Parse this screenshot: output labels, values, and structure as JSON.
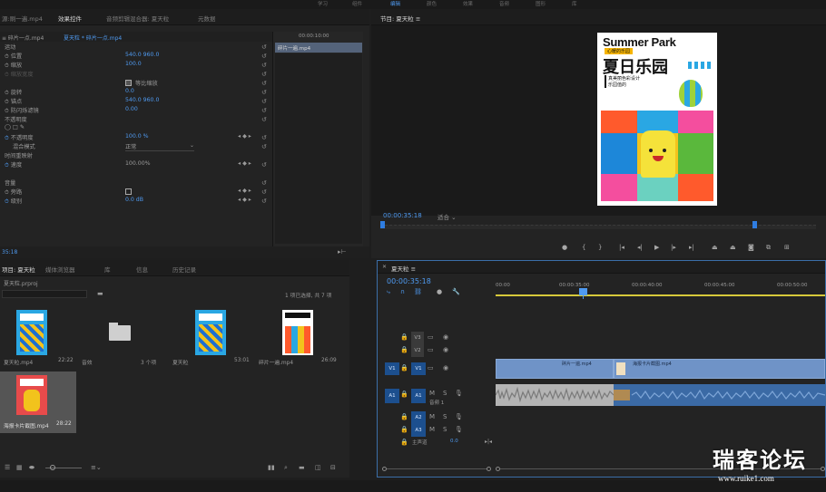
{
  "top_bar": {
    "items": [
      "学习",
      "组件",
      "编辑",
      "颜色",
      "效果",
      "音频",
      "图形",
      "库"
    ]
  },
  "effect_controls": {
    "tabs": [
      "源:刷一遍.mp4",
      "效果控件",
      "音频剪辑混合器: 夏天粒",
      "元数据"
    ],
    "source_path": "≡ 碎片一点.mp4",
    "source_seq": "夏天粒 * 碎片一点.mp4",
    "clip_label": "碎片一遍.mp4",
    "clip_time": "00:00:10:00",
    "sections": [
      "运动",
      "不透明度",
      "时间重映射",
      "音量"
    ],
    "rows": [
      {
        "label": "运动",
        "values": ""
      },
      {
        "label": "位置",
        "values": "540.0   960.0"
      },
      {
        "label": "缩放",
        "values": "100.0"
      },
      {
        "label": "缩放宽度",
        "values": ""
      },
      {
        "label": "",
        "values": "等比缩放"
      },
      {
        "label": "旋转",
        "values": "0.0"
      },
      {
        "label": "锚点",
        "values": "540.0   960.0"
      },
      {
        "label": "防闪烁滤镜",
        "values": "0.00"
      },
      {
        "label": "不透明度",
        "values": ""
      },
      {
        "label": "",
        "values": ""
      },
      {
        "label": "不透明度",
        "values": "100.0 %"
      },
      {
        "label": "混合模式",
        "values": "正常"
      },
      {
        "label": "时间重映射",
        "values": ""
      },
      {
        "label": "速度",
        "values": "100.00%"
      },
      {
        "label": "",
        "values": ""
      },
      {
        "label": "音量",
        "values": ""
      },
      {
        "label": "旁路",
        "values": ""
      },
      {
        "label": "级别",
        "values": "0.0 dB"
      }
    ],
    "time": "35:18"
  },
  "program": {
    "title": "节目: 夏天粒 ≡",
    "timecode": "00:00:35:18",
    "fit": "适合",
    "poster": {
      "title_en": "Summer Park",
      "subtitle_tag": "心暖的乐园",
      "title_cn": "夏日乐园",
      "line1": "真美丽色彩设计",
      "line2": "乐园值的"
    }
  },
  "project": {
    "tabs": [
      "项目: 夏天粒",
      "媒体浏览器",
      "库",
      "信息",
      "历史记录"
    ],
    "file": "夏天粒.prproj",
    "count": "1 项已选择, 共 7 项",
    "items": [
      {
        "name": "夏天粒.mp4",
        "dur": "22:22"
      },
      {
        "name": "音效",
        "dur": "3 个项"
      },
      {
        "name": "夏天粒",
        "dur": "53:01"
      },
      {
        "name": "碎片一遍.mp4",
        "dur": "26:09"
      },
      {
        "name": "海报卡片截图.mp4",
        "dur": "28:22"
      }
    ]
  },
  "timeline": {
    "title": "夏天粒 ≡",
    "timecode": "00:00:35:18",
    "ruler": [
      "00:00",
      "00:00:35:00",
      "00:00:40:00",
      "00:00:45:00",
      "00:00:50:00"
    ],
    "tracks": [
      {
        "id": "V3"
      },
      {
        "id": "V2"
      },
      {
        "id": "V1",
        "target": "V1"
      },
      {
        "id": "A1",
        "target": "A1",
        "name": "音频 1"
      },
      {
        "id": "A2"
      },
      {
        "id": "A3"
      }
    ],
    "master": "主声道",
    "master_val": "0.0",
    "clip1": "碎片一遍.mp4",
    "clip2": "海报卡片截图.mp4"
  },
  "watermark": {
    "cn": "瑞客论坛",
    "url": "www.ruike1.com"
  }
}
